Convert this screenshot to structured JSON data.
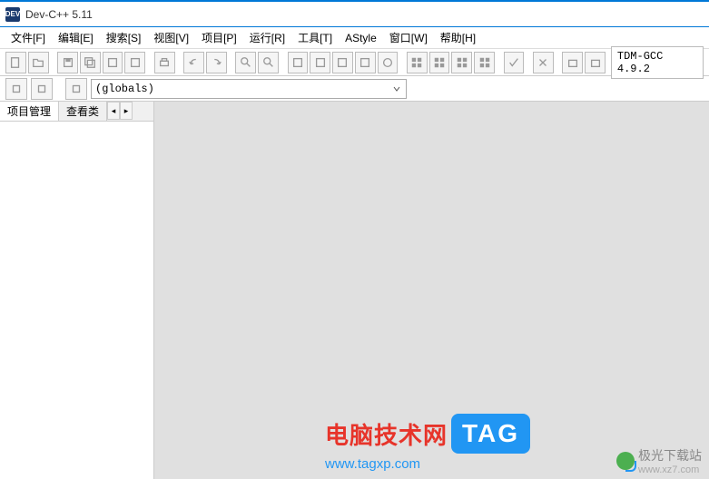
{
  "title": "Dev-C++ 5.11",
  "app_icon_text": "DEV",
  "menu": {
    "file": "文件[F]",
    "edit": "编辑[E]",
    "search": "搜索[S]",
    "view": "视图[V]",
    "project": "项目[P]",
    "run": "运行[R]",
    "tools": "工具[T]",
    "astyle": "AStyle",
    "window": "窗口[W]",
    "help": "帮助[H]"
  },
  "toolbar": {
    "compiler_label": "TDM-GCC 4.9.2"
  },
  "globals": {
    "value": "(globals)"
  },
  "sidebar": {
    "tab_project": "项目管理",
    "tab_view": "查看类",
    "nav_left": "◂",
    "nav_right": "▸"
  },
  "watermark1": {
    "title": "电脑技术网",
    "tag": "TAG",
    "url": "www.tagxp.com"
  },
  "watermark2": {
    "title": "极光下载站",
    "url": "www.xz7.com"
  }
}
